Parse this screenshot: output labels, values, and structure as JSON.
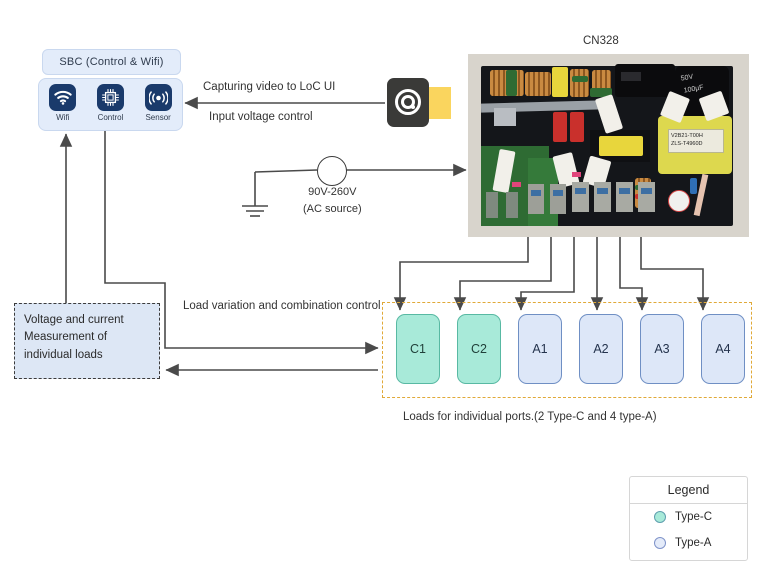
{
  "diagram": {
    "sbc": {
      "title": "SBC (Control & Wifi)",
      "icons": [
        {
          "label": "Wifi",
          "icon": "wifi-icon"
        },
        {
          "label": "Control",
          "icon": "chip-icon"
        },
        {
          "label": "Sensor",
          "icon": "sensor-broadcast-icon"
        }
      ]
    },
    "camera": {
      "icon": "camera-icon",
      "label_top": "Capturing video to LoC UI",
      "label_bottom": "Input voltage control"
    },
    "ac_source": {
      "icon": "ac-source-icon",
      "ground_icon": "ground-icon",
      "voltage": "90V-260V",
      "note": "(AC source)"
    },
    "board": {
      "title": "CN328",
      "photo_alt": "cn328-power-supply-board-photo",
      "cap_label_1": "50V",
      "cap_label_2": "100µF",
      "cap_label_3": "50V",
      "transformer_label_1": "V2B21-T00H",
      "transformer_label_2": "ZLS-T4960D"
    },
    "measurement_box": {
      "line1": "Voltage and current",
      "line2": "Measurement of",
      "line3": "individual loads"
    },
    "load_control": {
      "label": "Load variation and combination control"
    },
    "loads": {
      "caption": "Loads for individual ports.(2 Type-C and 4 type-A)",
      "items": [
        {
          "label": "C1",
          "type": "type-c"
        },
        {
          "label": "C2",
          "type": "type-c"
        },
        {
          "label": "A1",
          "type": "type-a"
        },
        {
          "label": "A2",
          "type": "type-a"
        },
        {
          "label": "A3",
          "type": "type-a"
        },
        {
          "label": "A4",
          "type": "type-a"
        }
      ]
    },
    "legend": {
      "title": "Legend",
      "entries": [
        {
          "label": "Type-C",
          "color": "#a8ead9"
        },
        {
          "label": "Type-A",
          "color": "#e4ebf9"
        }
      ]
    },
    "colors": {
      "type_c_fill": "#a8ead9",
      "type_a_fill": "#dde7f8",
      "dashed_group_border": "#e0a938",
      "sbc_fill": "#e3ecfa",
      "measure_fill": "#dde7f5",
      "wire": "#4a4a4a",
      "camera_beam": "#fad55e"
    }
  }
}
